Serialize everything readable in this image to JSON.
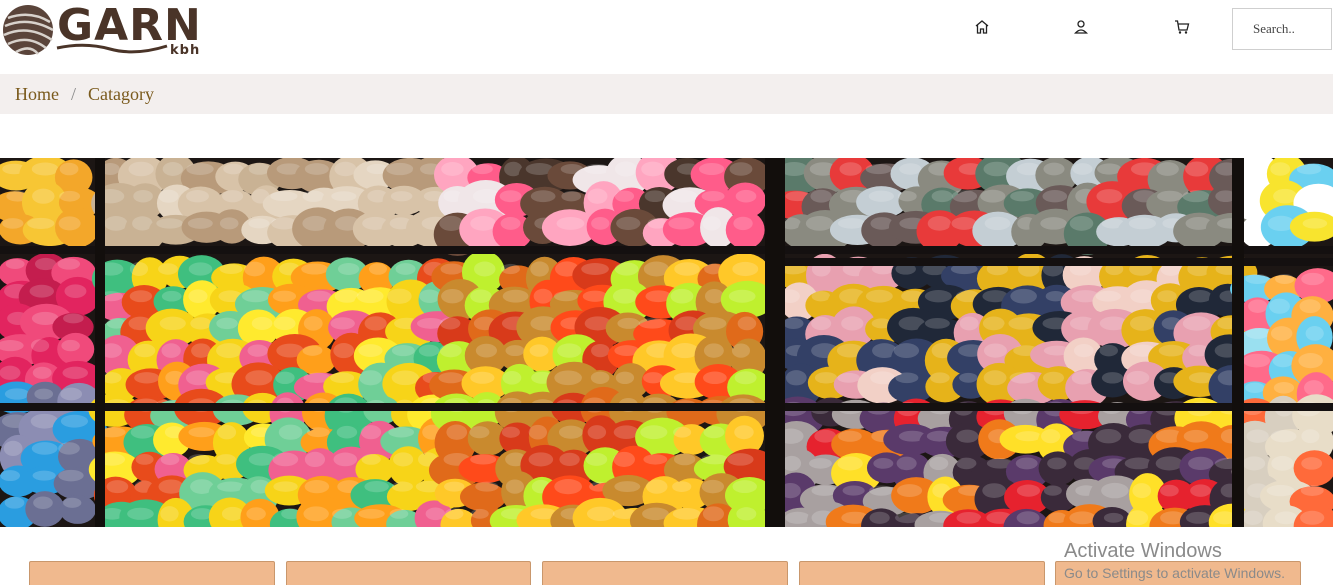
{
  "logo": {
    "main": "GARN",
    "sub": "kbh"
  },
  "nav": {
    "home_icon": "home-icon",
    "user_icon": "user-icon",
    "cart_icon": "cart-icon"
  },
  "search": {
    "placeholder": "Search.."
  },
  "breadcrumb": {
    "home": "Home",
    "separator": "/",
    "current": "Catagory"
  },
  "hero": {
    "subject": "yarn shelves image"
  },
  "cards": [
    {},
    {},
    {},
    {},
    {}
  ],
  "watermark": {
    "title": "Activate Windows",
    "subtitle": "Go to Settings to activate Windows."
  },
  "colors": {
    "brand": "#4a3428",
    "breadcrumb_text": "#7a5a1c",
    "breadcrumb_bg": "#f3efee",
    "card": "#f0b98e"
  }
}
